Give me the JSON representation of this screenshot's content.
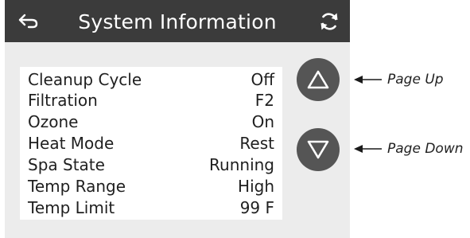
{
  "header": {
    "title": "System Information"
  },
  "info": {
    "rows": [
      {
        "label": "Cleanup Cycle",
        "value": "Off"
      },
      {
        "label": "Filtration",
        "value": "F2"
      },
      {
        "label": "Ozone",
        "value": "On"
      },
      {
        "label": "Heat Mode",
        "value": "Rest"
      },
      {
        "label": "Spa State",
        "value": "Running"
      },
      {
        "label": "Temp Range",
        "value": "High"
      },
      {
        "label": "Temp Limit",
        "value": "99 F"
      }
    ]
  },
  "callouts": {
    "page_up": "Page Up",
    "page_down": "Page Down"
  },
  "icons": {
    "back": "back-arrow-icon",
    "refresh": "refresh-icon",
    "page_up": "triangle-up-icon",
    "page_down": "triangle-down-icon"
  },
  "colors": {
    "header_bg": "#3b3b3b",
    "screen_bg": "#ececec",
    "panel_bg": "#ffffff",
    "nav_button": "#555555"
  }
}
